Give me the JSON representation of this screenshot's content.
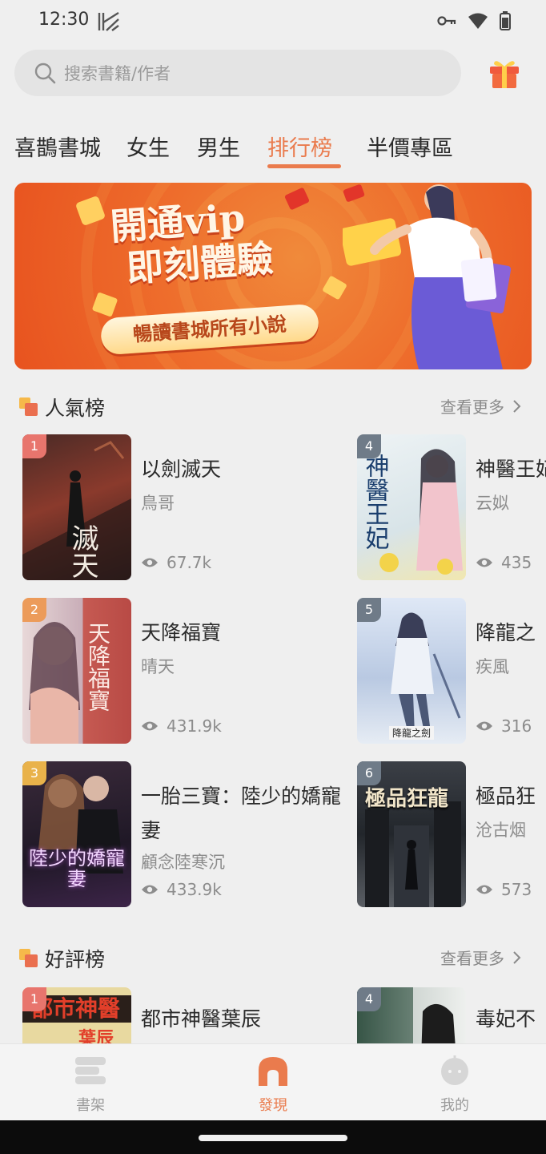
{
  "status": {
    "time": "12:30"
  },
  "search": {
    "placeholder": "搜索書籍/作者"
  },
  "tabs": [
    {
      "label": "喜鵲書城"
    },
    {
      "label": "女生"
    },
    {
      "label": "男生"
    },
    {
      "label": "排行榜",
      "active": true
    },
    {
      "label": "半價專區"
    }
  ],
  "banner": {
    "line1": "開通vip",
    "line2": "即刻體驗",
    "pill": "暢讀書城所有小說"
  },
  "sections": [
    {
      "title": "人氣榜",
      "more": "查看更多",
      "books": [
        {
          "rank": "1",
          "title": "以劍滅天",
          "author": "鳥哥",
          "views": "67.7k"
        },
        {
          "rank": "2",
          "title": "天降福寶",
          "author": "晴天",
          "views": "431.9k"
        },
        {
          "rank": "3",
          "title": "一胎三寶：陸少的嬌寵妻",
          "author": "顧念陸寒沉",
          "views": "433.9k"
        },
        {
          "rank": "4",
          "title": "神醫王妃",
          "author": "云姒",
          "views": "435"
        },
        {
          "rank": "5",
          "title": "降龍之",
          "author": "疾風",
          "views": "316"
        },
        {
          "rank": "6",
          "title": "極品狂",
          "author": "沧古烟",
          "views": "573"
        }
      ]
    },
    {
      "title": "好評榜",
      "more": "查看更多",
      "books": [
        {
          "rank": "1",
          "title": "都市神醫葉辰"
        },
        {
          "rank": "4",
          "title": "毒妃不"
        }
      ]
    }
  ],
  "covers": {
    "c1": "滅天",
    "c2": "天降福寶",
    "c3": "陸少的嬌寵妻",
    "c4": "神醫王妃",
    "c5": "降龍之劍",
    "c6": "極品狂龍",
    "c7a": "都市神醫",
    "c7b": "葉辰"
  },
  "nav": [
    {
      "label": "書架"
    },
    {
      "label": "發現",
      "active": true
    },
    {
      "label": "我的"
    }
  ],
  "colors": {
    "accent": "#ea7b4d",
    "rank1": "#e8756d",
    "rank2": "#ec9b5a",
    "rank3": "#e9b24a",
    "rankN": "#6f7b88"
  }
}
